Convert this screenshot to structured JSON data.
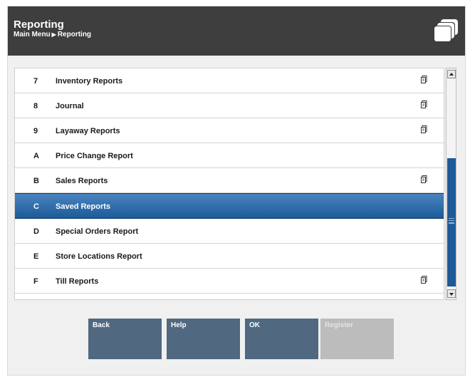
{
  "header": {
    "title": "Reporting",
    "breadcrumb": [
      "Main Menu",
      "Reporting"
    ],
    "icon": "windows-icon"
  },
  "list": {
    "items": [
      {
        "key": "7",
        "label": "Inventory Reports",
        "has_doc_icon": true,
        "selected": false
      },
      {
        "key": "8",
        "label": "Journal",
        "has_doc_icon": true,
        "selected": false
      },
      {
        "key": "9",
        "label": "Layaway Reports",
        "has_doc_icon": true,
        "selected": false
      },
      {
        "key": "A",
        "label": "Price Change Report",
        "has_doc_icon": false,
        "selected": false
      },
      {
        "key": "B",
        "label": "Sales Reports",
        "has_doc_icon": true,
        "selected": false
      },
      {
        "key": "C",
        "label": "Saved Reports",
        "has_doc_icon": false,
        "selected": true
      },
      {
        "key": "D",
        "label": "Special Orders Report",
        "has_doc_icon": false,
        "selected": false
      },
      {
        "key": "E",
        "label": "Store Locations Report",
        "has_doc_icon": false,
        "selected": false
      },
      {
        "key": "F",
        "label": "Till Reports",
        "has_doc_icon": true,
        "selected": false
      }
    ]
  },
  "buttons": [
    {
      "label": "Back",
      "enabled": true
    },
    {
      "label": "Help",
      "enabled": true
    },
    {
      "label": "OK",
      "enabled": true
    },
    {
      "label": "Register",
      "enabled": false
    }
  ],
  "colors": {
    "header_bg": "#3e3e3e",
    "selection": "#1c5a98",
    "button_bg": "#506880",
    "button_disabled": "#bcbcbc"
  }
}
